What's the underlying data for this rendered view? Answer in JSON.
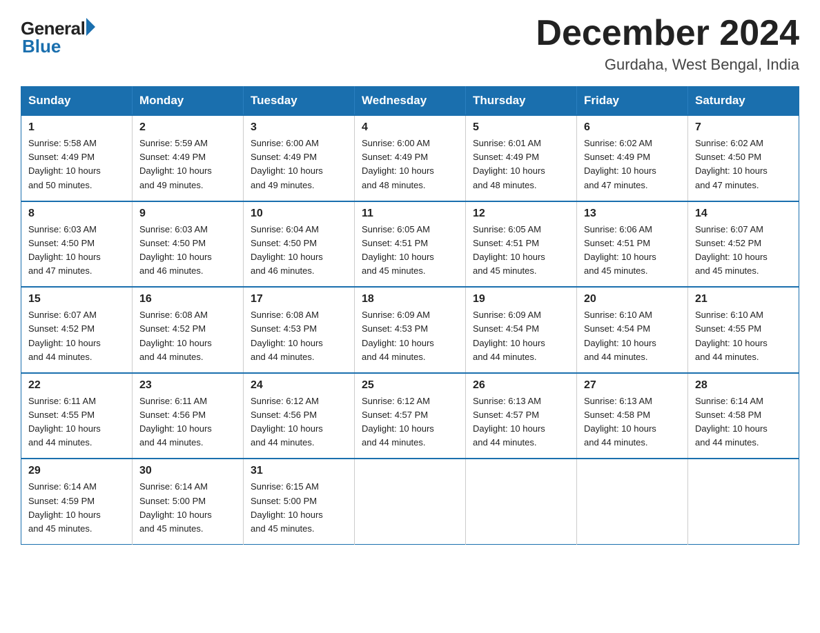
{
  "logo": {
    "text_general": "General",
    "text_blue": "Blue"
  },
  "title": "December 2024",
  "subtitle": "Gurdaha, West Bengal, India",
  "weekdays": [
    "Sunday",
    "Monday",
    "Tuesday",
    "Wednesday",
    "Thursday",
    "Friday",
    "Saturday"
  ],
  "weeks": [
    [
      {
        "day": "1",
        "sunrise": "5:58 AM",
        "sunset": "4:49 PM",
        "daylight": "10 hours and 50 minutes."
      },
      {
        "day": "2",
        "sunrise": "5:59 AM",
        "sunset": "4:49 PM",
        "daylight": "10 hours and 49 minutes."
      },
      {
        "day": "3",
        "sunrise": "6:00 AM",
        "sunset": "4:49 PM",
        "daylight": "10 hours and 49 minutes."
      },
      {
        "day": "4",
        "sunrise": "6:00 AM",
        "sunset": "4:49 PM",
        "daylight": "10 hours and 48 minutes."
      },
      {
        "day": "5",
        "sunrise": "6:01 AM",
        "sunset": "4:49 PM",
        "daylight": "10 hours and 48 minutes."
      },
      {
        "day": "6",
        "sunrise": "6:02 AM",
        "sunset": "4:49 PM",
        "daylight": "10 hours and 47 minutes."
      },
      {
        "day": "7",
        "sunrise": "6:02 AM",
        "sunset": "4:50 PM",
        "daylight": "10 hours and 47 minutes."
      }
    ],
    [
      {
        "day": "8",
        "sunrise": "6:03 AM",
        "sunset": "4:50 PM",
        "daylight": "10 hours and 47 minutes."
      },
      {
        "day": "9",
        "sunrise": "6:03 AM",
        "sunset": "4:50 PM",
        "daylight": "10 hours and 46 minutes."
      },
      {
        "day": "10",
        "sunrise": "6:04 AM",
        "sunset": "4:50 PM",
        "daylight": "10 hours and 46 minutes."
      },
      {
        "day": "11",
        "sunrise": "6:05 AM",
        "sunset": "4:51 PM",
        "daylight": "10 hours and 45 minutes."
      },
      {
        "day": "12",
        "sunrise": "6:05 AM",
        "sunset": "4:51 PM",
        "daylight": "10 hours and 45 minutes."
      },
      {
        "day": "13",
        "sunrise": "6:06 AM",
        "sunset": "4:51 PM",
        "daylight": "10 hours and 45 minutes."
      },
      {
        "day": "14",
        "sunrise": "6:07 AM",
        "sunset": "4:52 PM",
        "daylight": "10 hours and 45 minutes."
      }
    ],
    [
      {
        "day": "15",
        "sunrise": "6:07 AM",
        "sunset": "4:52 PM",
        "daylight": "10 hours and 44 minutes."
      },
      {
        "day": "16",
        "sunrise": "6:08 AM",
        "sunset": "4:52 PM",
        "daylight": "10 hours and 44 minutes."
      },
      {
        "day": "17",
        "sunrise": "6:08 AM",
        "sunset": "4:53 PM",
        "daylight": "10 hours and 44 minutes."
      },
      {
        "day": "18",
        "sunrise": "6:09 AM",
        "sunset": "4:53 PM",
        "daylight": "10 hours and 44 minutes."
      },
      {
        "day": "19",
        "sunrise": "6:09 AM",
        "sunset": "4:54 PM",
        "daylight": "10 hours and 44 minutes."
      },
      {
        "day": "20",
        "sunrise": "6:10 AM",
        "sunset": "4:54 PM",
        "daylight": "10 hours and 44 minutes."
      },
      {
        "day": "21",
        "sunrise": "6:10 AM",
        "sunset": "4:55 PM",
        "daylight": "10 hours and 44 minutes."
      }
    ],
    [
      {
        "day": "22",
        "sunrise": "6:11 AM",
        "sunset": "4:55 PM",
        "daylight": "10 hours and 44 minutes."
      },
      {
        "day": "23",
        "sunrise": "6:11 AM",
        "sunset": "4:56 PM",
        "daylight": "10 hours and 44 minutes."
      },
      {
        "day": "24",
        "sunrise": "6:12 AM",
        "sunset": "4:56 PM",
        "daylight": "10 hours and 44 minutes."
      },
      {
        "day": "25",
        "sunrise": "6:12 AM",
        "sunset": "4:57 PM",
        "daylight": "10 hours and 44 minutes."
      },
      {
        "day": "26",
        "sunrise": "6:13 AM",
        "sunset": "4:57 PM",
        "daylight": "10 hours and 44 minutes."
      },
      {
        "day": "27",
        "sunrise": "6:13 AM",
        "sunset": "4:58 PM",
        "daylight": "10 hours and 44 minutes."
      },
      {
        "day": "28",
        "sunrise": "6:14 AM",
        "sunset": "4:58 PM",
        "daylight": "10 hours and 44 minutes."
      }
    ],
    [
      {
        "day": "29",
        "sunrise": "6:14 AM",
        "sunset": "4:59 PM",
        "daylight": "10 hours and 45 minutes."
      },
      {
        "day": "30",
        "sunrise": "6:14 AM",
        "sunset": "5:00 PM",
        "daylight": "10 hours and 45 minutes."
      },
      {
        "day": "31",
        "sunrise": "6:15 AM",
        "sunset": "5:00 PM",
        "daylight": "10 hours and 45 minutes."
      },
      null,
      null,
      null,
      null
    ]
  ],
  "labels": {
    "sunrise": "Sunrise:",
    "sunset": "Sunset:",
    "daylight": "Daylight:"
  }
}
